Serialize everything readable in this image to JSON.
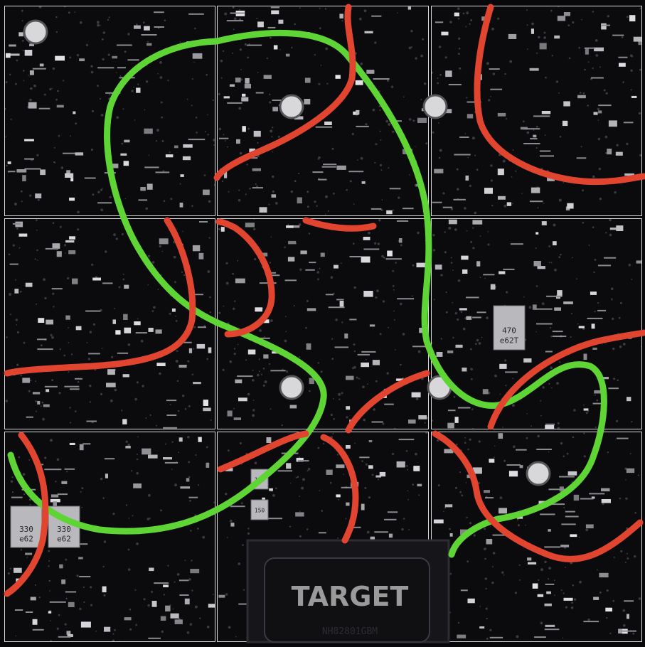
{
  "puzzle": {
    "grid_rows": 3,
    "grid_cols": 3,
    "tile_count": 9,
    "target_chip_label": "TARGET",
    "chip_part_number": "NH82801GBM",
    "capacitor_labels": [
      {
        "top": "330",
        "bottom": "e62"
      },
      {
        "top": "330",
        "bottom": "e62"
      },
      {
        "top": "470",
        "bottom": "e62T"
      },
      {
        "top": "150",
        "bottom": ""
      },
      {
        "top": "150",
        "bottom": ""
      }
    ],
    "colors": {
      "border": "#dcdcdc",
      "board": "#0b0b0e",
      "green_path": "#5ed435",
      "red_path": "#e2452f",
      "chip_label": "#9a9a9a"
    }
  }
}
